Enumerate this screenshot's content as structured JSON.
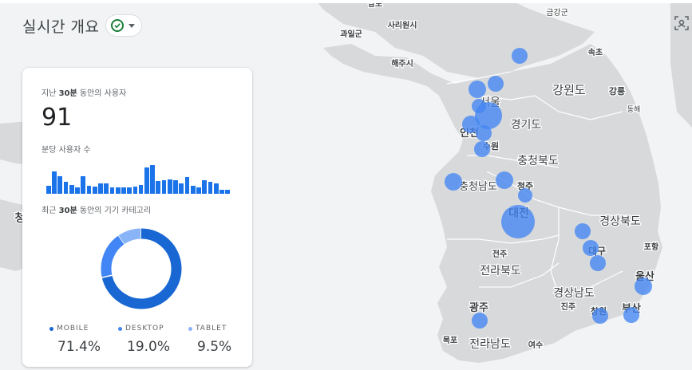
{
  "header": {
    "title": "실시간 개요"
  },
  "card": {
    "users_label_pre": "지난 ",
    "users_label_bold": "30분",
    "users_label_post": " 동안의 사용자",
    "users_count": "91",
    "per_minute_label": "분당 사용자 수",
    "device_label_pre": "최근 ",
    "device_label_bold": "30분",
    "device_label_post": " 동안의 기기 카테고리",
    "per_minute_values": [
      10,
      27,
      21,
      15,
      11,
      8,
      21,
      10,
      9,
      13,
      13,
      8,
      8,
      8,
      8,
      9,
      11,
      32,
      35,
      16,
      17,
      18,
      17,
      13,
      20,
      10,
      8,
      17,
      15,
      13,
      5,
      5
    ],
    "devices": [
      {
        "name": "MOBILE",
        "percent": "71.4%",
        "value": 71.4,
        "color": "#1967d2"
      },
      {
        "name": "DESKTOP",
        "percent": "19.0%",
        "value": 19.0,
        "color": "#4285f4"
      },
      {
        "name": "TABLET",
        "percent": "9.5%",
        "value": 9.5,
        "color": "#8ab4f8"
      }
    ]
  },
  "map": {
    "labels": [
      {
        "text": "남포"
      },
      {
        "text": "금강군"
      },
      {
        "text": "사리원시"
      },
      {
        "text": "과일군"
      },
      {
        "text": "속초"
      },
      {
        "text": "해주시"
      },
      {
        "text": "강원도"
      },
      {
        "text": "강릉"
      },
      {
        "text": "서울"
      },
      {
        "text": "동해"
      },
      {
        "text": "인천"
      },
      {
        "text": "경기도"
      },
      {
        "text": "수원"
      },
      {
        "text": "충청북도"
      },
      {
        "text": "충청남도"
      },
      {
        "text": "청주"
      },
      {
        "text": "대전"
      },
      {
        "text": "경상북도"
      },
      {
        "text": "포항"
      },
      {
        "text": "대구"
      },
      {
        "text": "전주"
      },
      {
        "text": "전라북도"
      },
      {
        "text": "울산"
      },
      {
        "text": "경상남도"
      },
      {
        "text": "진주"
      },
      {
        "text": "광주"
      },
      {
        "text": "창원"
      },
      {
        "text": "부산"
      },
      {
        "text": "목포"
      },
      {
        "text": "전라남도"
      },
      {
        "text": "여수"
      },
      {
        "text": "청"
      }
    ],
    "bubble_color": "#4285f4"
  }
}
